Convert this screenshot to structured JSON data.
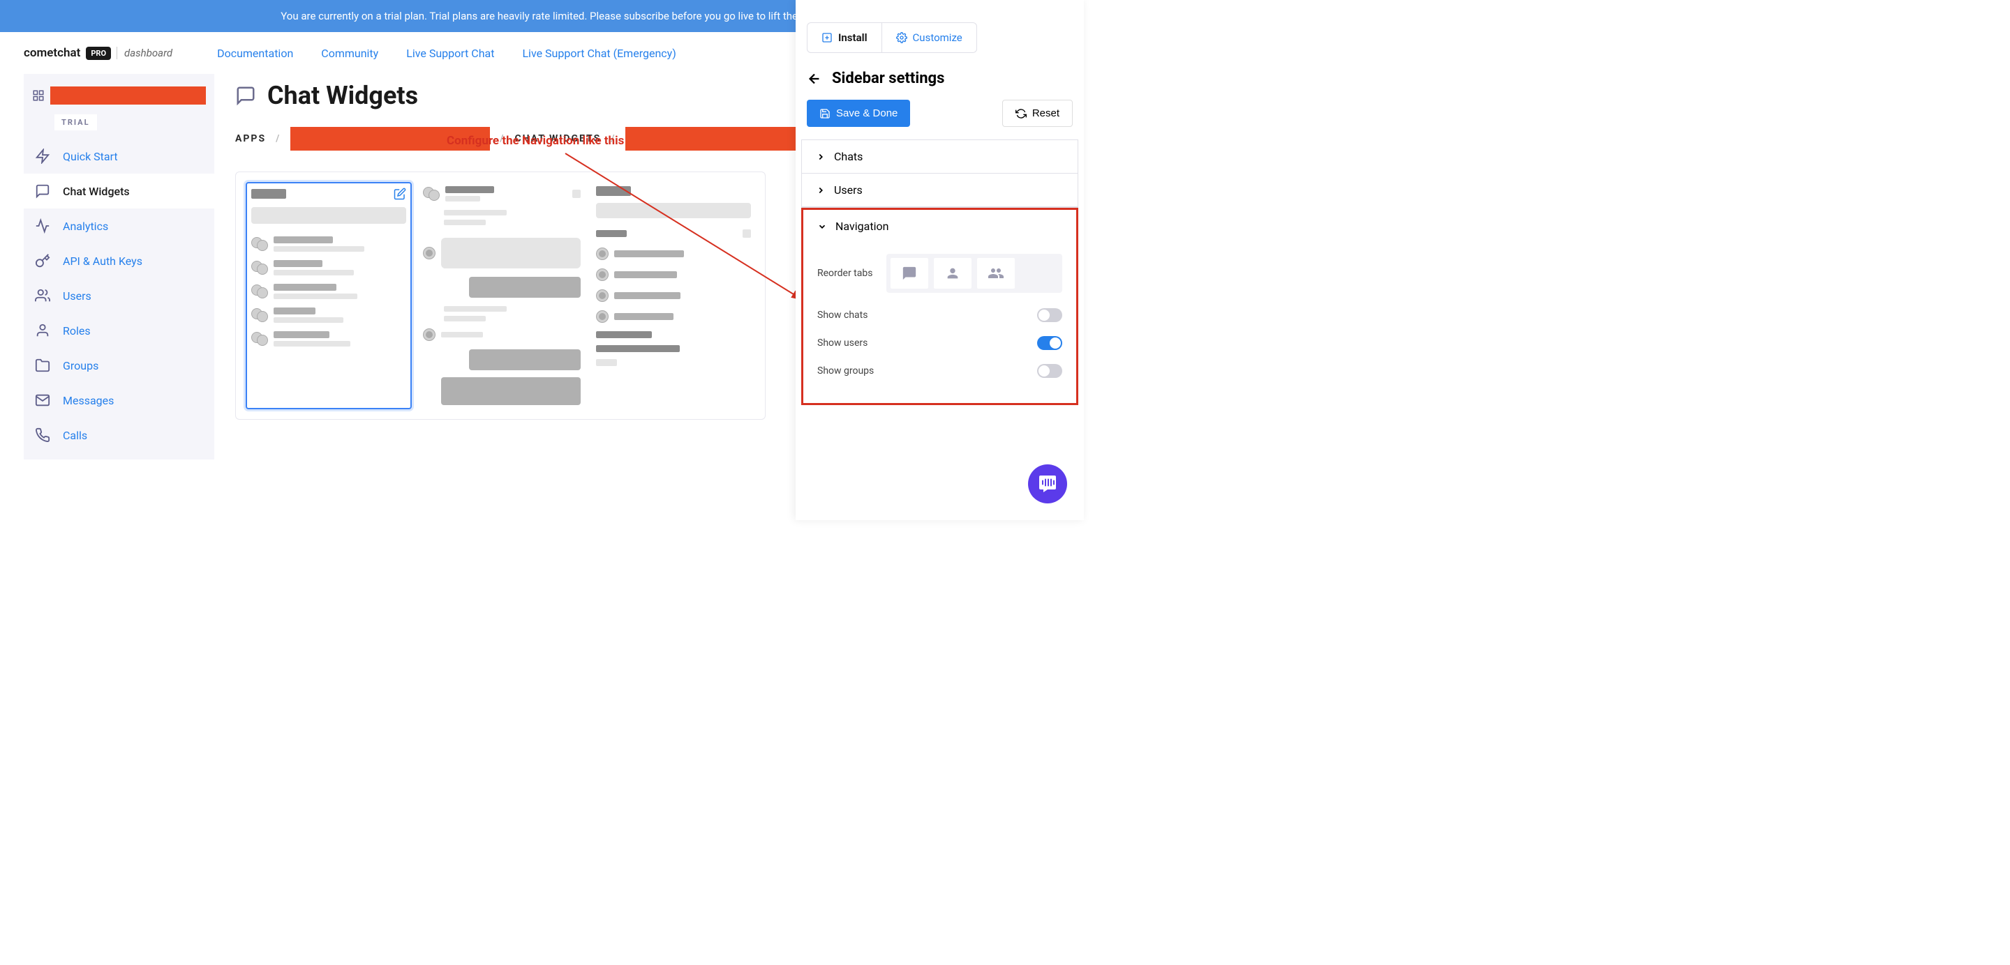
{
  "banner": "You are currently on a trial plan. Trial plans are heavily rate limited. Please subscribe before you go live to lift thes",
  "logo": {
    "brand": "cometchat",
    "pro": "PRO",
    "dash": "dashboard"
  },
  "header_links": [
    "Documentation",
    "Community",
    "Live Support Chat",
    "Live Support Chat (Emergency)"
  ],
  "sidebar": {
    "badge": "TRIAL",
    "items": [
      {
        "label": "Quick Start",
        "active": false
      },
      {
        "label": "Chat Widgets",
        "active": true
      },
      {
        "label": "Analytics",
        "active": false
      },
      {
        "label": "API & Auth Keys",
        "active": false
      },
      {
        "label": "Users",
        "active": false
      },
      {
        "label": "Roles",
        "active": false
      },
      {
        "label": "Groups",
        "active": false
      },
      {
        "label": "Messages",
        "active": false
      },
      {
        "label": "Calls",
        "active": false
      }
    ]
  },
  "page": {
    "title": "Chat Widgets",
    "breadcrumb": {
      "apps": "APPS",
      "chat_widgets": "CHAT WIDGETS"
    }
  },
  "annotation": "Configure the Navigation like this",
  "panel": {
    "tabs": {
      "install": "Install",
      "customize": "Customize"
    },
    "title": "Sidebar settings",
    "save": "Save & Done",
    "reset": "Reset",
    "sections": {
      "chats": "Chats",
      "users": "Users",
      "navigation": "Navigation"
    },
    "navigation": {
      "reorder": "Reorder tabs",
      "show_chats": "Show chats",
      "show_users": "Show users",
      "show_groups": "Show groups",
      "toggles": {
        "chats": false,
        "users": true,
        "groups": false
      }
    }
  }
}
